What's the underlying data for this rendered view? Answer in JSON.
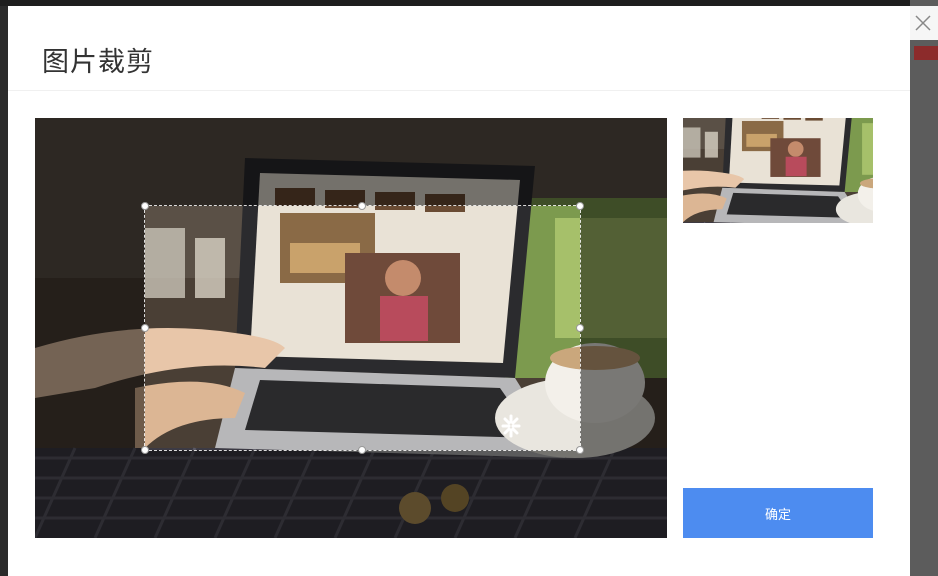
{
  "modal": {
    "title": "图片裁剪",
    "confirm_label": "确定"
  },
  "icons": {
    "close": "close-icon",
    "watermark": "brand-watermark-icon"
  },
  "colors": {
    "accent": "#4d8cf0",
    "overlay": "rgba(0,0,0,0.5)"
  }
}
